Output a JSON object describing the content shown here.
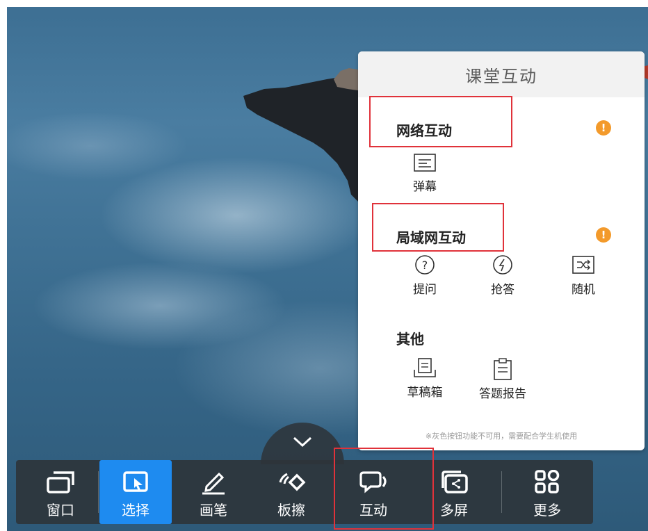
{
  "panel": {
    "title": "课堂互动",
    "sections": [
      {
        "title": "网络互动",
        "items": [
          {
            "label": "弹幕",
            "icon": "danmaku-icon"
          }
        ]
      },
      {
        "title": "局域网互动",
        "items": [
          {
            "label": "提问",
            "icon": "question-icon"
          },
          {
            "label": "抢答",
            "icon": "quick-answer-icon"
          },
          {
            "label": "随机",
            "icon": "shuffle-icon"
          }
        ]
      },
      {
        "title": "其他",
        "items": [
          {
            "label": "草稿箱",
            "icon": "drafts-icon"
          },
          {
            "label": "答题报告",
            "icon": "answer-report-icon"
          }
        ]
      }
    ],
    "warning_badge": "!",
    "note": "※灰色按钮功能不可用，需要配合学生机使用"
  },
  "toolbar": {
    "items": [
      {
        "label": "窗口",
        "icon": "window-icon"
      },
      {
        "label": "选择",
        "icon": "select-cursor-icon",
        "active": true
      },
      {
        "label": "画笔",
        "icon": "pen-icon"
      },
      {
        "label": "板擦",
        "icon": "eraser-icon"
      },
      {
        "label": "互动",
        "icon": "interaction-icon"
      },
      {
        "label": "多屏",
        "icon": "multi-screen-icon"
      },
      {
        "label": "更多",
        "icon": "more-grid-icon"
      }
    ],
    "collapse_icon": "chevron-down-icon"
  },
  "colors": {
    "accent": "#1e8bf0",
    "warning": "#f39a2b",
    "highlight": "#e0323a"
  }
}
